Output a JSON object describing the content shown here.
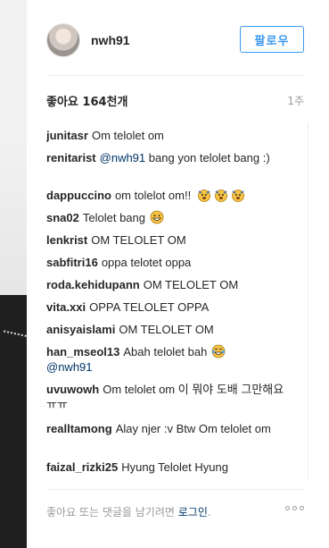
{
  "post": {
    "username": "nwh91",
    "follow_label": "팔로우",
    "likes_text": "좋아요 164천개",
    "time_ago": "1주"
  },
  "comments": [
    {
      "user": "junitasr",
      "text": "Om telolet om"
    },
    {
      "user": "renitarist",
      "mention": "@nwh91",
      "text": "bang yon telolet bang :)"
    },
    {
      "user": "dappuccino",
      "text": "om tolelot om!!",
      "emojis": [
        "trumpet-face-emoji",
        "trumpet-face-emoji",
        "trumpet-face-emoji"
      ]
    },
    {
      "user": "sna02",
      "text": "Telolet bang",
      "emojis": [
        "grinning-face-emoji"
      ]
    },
    {
      "user": "lenkrist",
      "text": "OM TELOLET OM"
    },
    {
      "user": "sabfitri16",
      "text": "oppa telotet oppa"
    },
    {
      "user": "roda.kehidupann",
      "text": "OM TELOLET OM"
    },
    {
      "user": "vita.xxi",
      "text": "OPPA TELOLET OPPA"
    },
    {
      "user": "anisyaislami",
      "text": "OM TELOLET OM"
    },
    {
      "user": "han_mseol13",
      "text": "Abah telolet bah",
      "emojis": [
        "tears-of-joy-emoji"
      ],
      "mention": "@nwh91"
    },
    {
      "user": "uvuwowh",
      "text": "Om telolet om 이 뭐야 도배 그만해요ㅠㅠ"
    },
    {
      "user": "realltamong",
      "text": "Alay njer :v Btw Om telolet om"
    },
    {
      "user": "faizal_rizki25",
      "text": "Hyung Telolet Hyung"
    }
  ],
  "footer": {
    "prompt_text": "좋아요 또는 댓글을 남기려면",
    "login_label": "로그인",
    "period": ".",
    "more_icon": "more-options-icon"
  },
  "colors": {
    "accent": "#3897f0",
    "link": "#003569",
    "muted": "#999999",
    "text": "#262626"
  }
}
